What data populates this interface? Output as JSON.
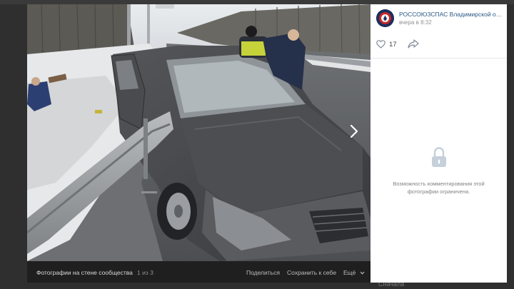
{
  "page": {
    "background_hint": "Сначала"
  },
  "photo": {
    "alt": "car after collision with guardrail"
  },
  "viewer": {
    "album_title": "Фотографии на стене сообщества",
    "counter": "1 из 3",
    "actions": {
      "share": "Поделиться",
      "save": "Сохранить к себе",
      "more": "Ещё"
    }
  },
  "post": {
    "author": "РОССОЮЗСПАС Владимирской об...",
    "time": "вчера в 8:32",
    "likes": "17",
    "comments_restricted": "Возможность комментирования этой фотографии ограничена."
  },
  "colors": {
    "link": "#2a5885",
    "panel_bg": "#ffffff",
    "bar_bg": "#1f1f1f"
  }
}
